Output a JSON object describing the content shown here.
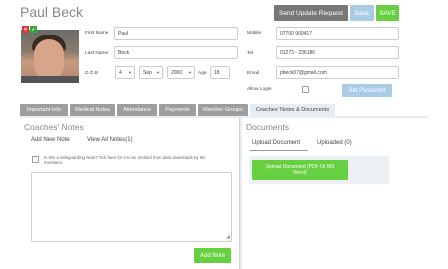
{
  "header": {
    "player_name": "Paul Beck",
    "buttons": {
      "send_update": "Send Update Request",
      "back": "Back",
      "save": "SAVE"
    },
    "badges": {
      "x_label": "✕",
      "ok_label": "✓"
    }
  },
  "profile": {
    "first_name_label": "First Name",
    "first_name_value": "Paul",
    "last_name_label": "Last Name",
    "last_name_value": "Beck",
    "dob_label": "D.O.B",
    "dob_day": "4",
    "dob_month": "Sep",
    "dob_year": "2000",
    "age_label": "Age",
    "age_value": "18",
    "mobile_label": "Mobile",
    "mobile_value": "07700 900417",
    "tel_label": "Tel",
    "tel_value": "01273 - 236186",
    "email_label": "Email",
    "email_value": "pbeck07@gmail.com",
    "allow_login_label": "Allow Login",
    "set_password_label": "Set Password"
  },
  "tabs": [
    {
      "label": "Important Info"
    },
    {
      "label": "Medical Notes"
    },
    {
      "label": "Attendance"
    },
    {
      "label": "Payments"
    },
    {
      "label": "Member Groups"
    },
    {
      "label": "Coaches' Notes & Documents"
    }
  ],
  "notes": {
    "title": "Coaches' Notes",
    "add_new": "Add New Note",
    "view_all": "View All Notes(1)",
    "safeguarding_text": "Is this a safeguarding Note? Tick here for it to be omitted from data downloads by the members.",
    "add_note_button": "Add Note"
  },
  "documents": {
    "title": "Documents",
    "upload_tab": "Upload Document",
    "uploaded_tab": "Uploaded (0)",
    "upload_button": "Upload Document (PDF Or MS Word)"
  },
  "colors": {
    "green": "#66d040",
    "light_blue": "#a9cbe6",
    "grey": "#777777"
  }
}
